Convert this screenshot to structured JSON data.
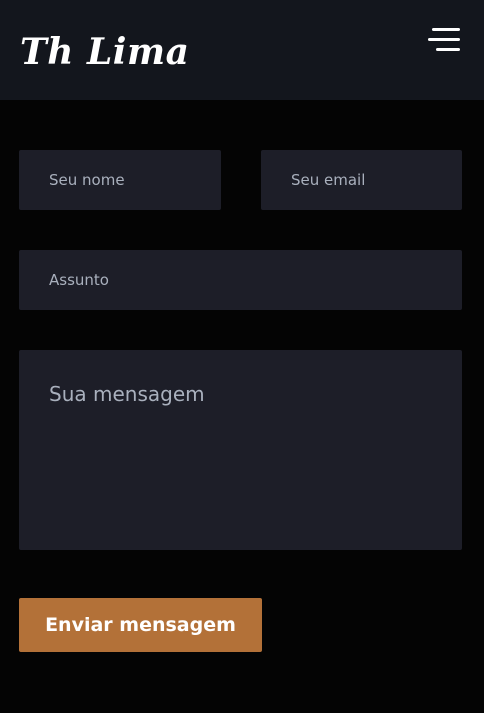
{
  "header": {
    "logo_text": "Th Lima",
    "menu_icon": "hamburger-menu-icon"
  },
  "form": {
    "name_placeholder": "Seu nome",
    "email_placeholder": "Seu email",
    "subject_placeholder": "Assunto",
    "message_placeholder": "Sua mensagem",
    "submit_label": "Enviar mensagem"
  },
  "colors": {
    "background": "#040404",
    "header_background": "#13161d",
    "field_background": "#1d1e28",
    "placeholder_text": "#a9b0bd",
    "accent": "#b37138"
  }
}
